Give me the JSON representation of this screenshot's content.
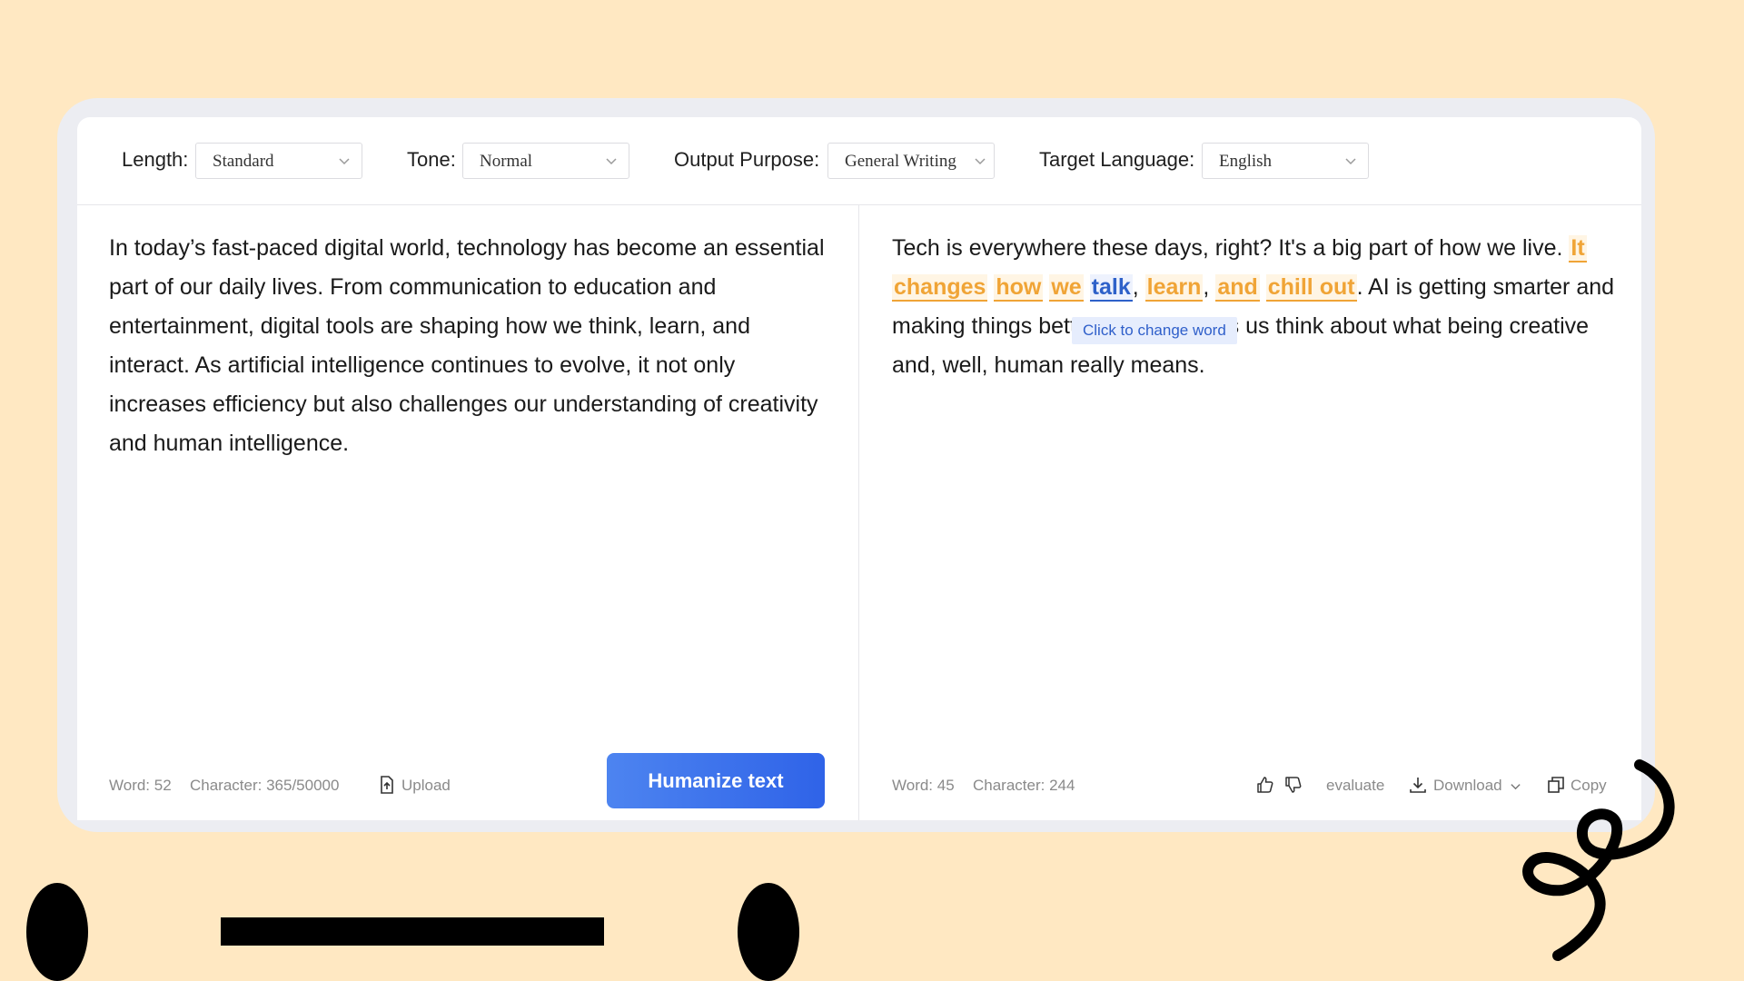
{
  "settings": {
    "length_label": "Length:",
    "length_value": "Standard",
    "tone_label": "Tone:",
    "tone_value": "Normal",
    "purpose_label": "Output Purpose:",
    "purpose_value": "General Writing",
    "language_label": "Target Language:",
    "language_value": "English"
  },
  "input": {
    "text": "In today’s fast-paced digital world, technology has become an essential part of our daily lives. From communication to education and entertainment, digital tools are shaping how we think, learn, and interact. As artificial intelligence continues to evolve, it not only increases efficiency but also challenges our understanding of creativity and human intelligence.",
    "word_count": "Word: 52",
    "char_count": "Character: 365/50000",
    "upload_label": "Upload",
    "humanize_label": "Humanize text"
  },
  "output": {
    "seg1": "Tech is everywhere these days, right?  It's a big part of how we live. ",
    "hl_it": "It",
    "hl_changes": "changes",
    "hl_how": "how",
    "hl_we": "we",
    "hl_talk": "talk",
    "comma1": ", ",
    "hl_learn": "learn",
    "comma2": ", ",
    "hl_and": "and",
    "hl_chill": "chill out",
    "period": ".",
    "seg2": "  AI is getting smarter and making things better, which makes us think about what being creative and, well, human really means.",
    "tooltip": "Click to change word",
    "word_count": "Word: 45",
    "char_count": "Character: 244",
    "evaluate_label": "evaluate",
    "download_label": "Download",
    "copy_label": "Copy"
  },
  "icons": {
    "thumbs_up": "thumbs-up-icon",
    "thumbs_down": "thumbs-down-icon",
    "upload": "upload-icon",
    "download": "download-icon",
    "copy": "copy-icon",
    "chevron": "chevron-down-icon"
  },
  "colors": {
    "background": "#FFE8C2",
    "accent_blue": "#2F63E8",
    "highlight_orange": "#F0A436",
    "selected_blue": "#2E61C9"
  }
}
